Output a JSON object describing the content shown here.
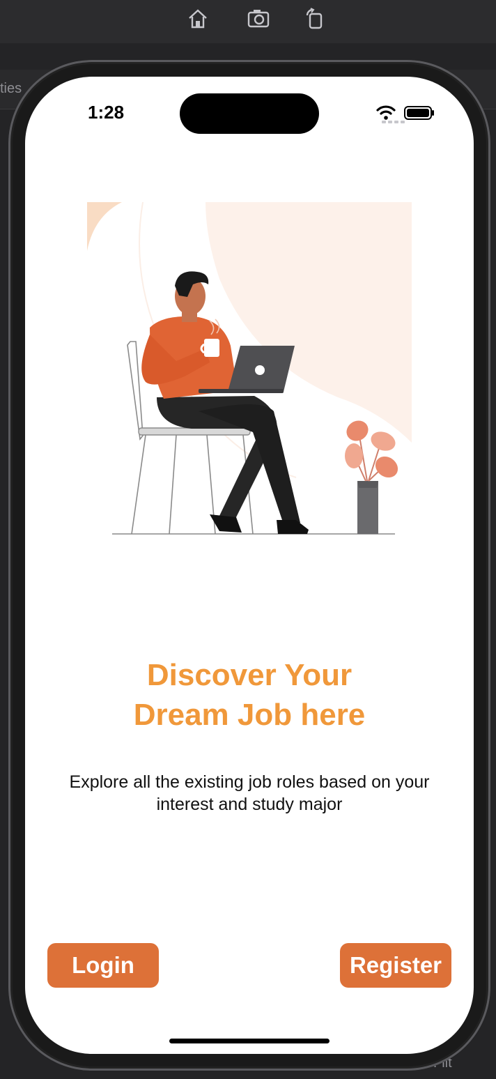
{
  "simulator": {
    "toolbar_icons": [
      "home-icon",
      "screenshot-icon",
      "rotate-icon"
    ]
  },
  "background_ide": {
    "tab_text": "ties",
    "filter_text": "Filt"
  },
  "status_bar": {
    "time": "1:28",
    "icons": [
      "signal-icon",
      "wifi-icon",
      "battery-icon"
    ]
  },
  "onboarding": {
    "headline_line1": "Discover Your",
    "headline_line2": "Dream Job here",
    "subtitle_line1": "Explore all the existing job roles based on your",
    "subtitle_line2": "interest and study major",
    "illustration": "person-working-on-laptop-illustration"
  },
  "buttons": {
    "login_label": "Login",
    "register_label": "Register"
  },
  "colors": {
    "headline": "#f0983a",
    "button_bg": "#dd7138",
    "button_text": "#ffffff",
    "screen_bg": "#ffffff"
  }
}
